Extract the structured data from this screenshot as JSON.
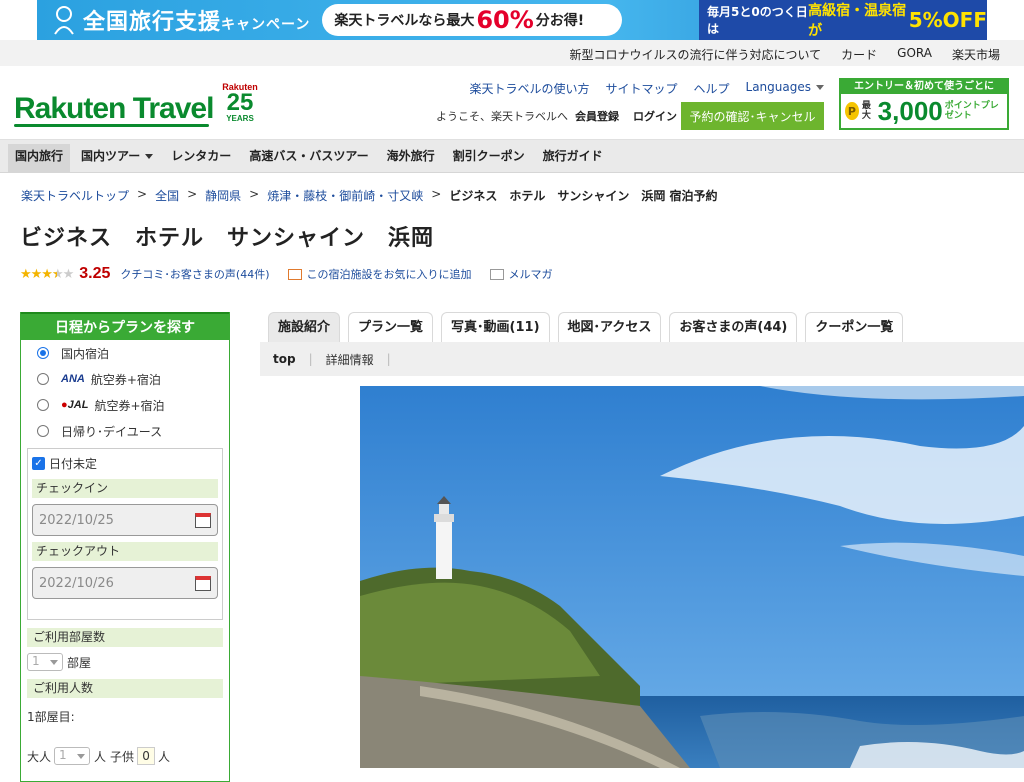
{
  "banner": {
    "title": "全国旅行支援",
    "title_suffix": "キャンペーン",
    "pill_prefix": "楽天トラベルなら最大",
    "pill_value": "60%",
    "pill_suffix": "分お得!",
    "right_prefix": "毎月5と0のつく日は",
    "right_middle": "高級宿・温泉宿が",
    "right_value": "5%OFF"
  },
  "utility": [
    "新型コロナウイルスの流行に伴う対応について",
    "カード",
    "GORA",
    "楽天市場"
  ],
  "header": {
    "logo": "Rakuten Travel",
    "years_brand": "Rakuten",
    "years_number": "25",
    "years_label": "YEARS",
    "links": [
      "楽天トラベルの使い方",
      "サイトマップ",
      "ヘルプ"
    ],
    "languages": "Languages",
    "welcome": "ようこそ、楽天トラベルへ",
    "member": "会員登録",
    "login": "ログイン",
    "confirm": "予約の確認･キャンセル",
    "promo_top": "エントリー＆初めて使うごとに",
    "promo_coin": "P",
    "promo_pre": "最大",
    "promo_amount": "3,000",
    "promo_suffix": "ポイントプレゼント"
  },
  "nav": [
    "国内旅行",
    "国内ツアー",
    "レンタカー",
    "高速バス・バスツアー",
    "海外旅行",
    "割引クーポン",
    "旅行ガイド"
  ],
  "breadcrumb": [
    "楽天トラベルトップ",
    "全国",
    "静岡県",
    "焼津・藤枝・御前崎・寸又峡"
  ],
  "breadcrumb_current": "ビジネス　ホテル　サンシャイン　浜岡 宿泊予約",
  "breadcrumb_sep": ">",
  "hotel": {
    "title": "ビジネス　ホテル　サンシャイン　浜岡",
    "rating": 3.25,
    "score": "3.25",
    "reviews": "クチコミ･お客さまの声(44件)",
    "favorite": "この宿泊施設をお気に入りに追加",
    "mailmag": "メルマガ"
  },
  "search": {
    "title": "日程からプランを探す",
    "options": [
      "国内宿泊",
      "航空券+宿泊",
      "航空券+宿泊",
      "日帰り･デイユース"
    ],
    "ana": "ANA",
    "jal": "JAL",
    "date_undecided": "日付未定",
    "checkin_label": "チェックイン",
    "checkin": "2022/10/25",
    "checkout_label": "チェックアウト",
    "checkout": "2022/10/26",
    "rooms_label": "ご利用部屋数",
    "rooms": "1",
    "rooms_unit": "部屋",
    "guests_label": "ご利用人数",
    "room1": "1部屋目:",
    "adult_label": "大人",
    "adult": "1",
    "person_unit": "人",
    "child_label": "子供",
    "child": "0"
  },
  "tabs": [
    "施設紹介",
    "プラン一覧",
    "写真･動画(11)",
    "地図･アクセス",
    "お客さまの声(44)",
    "クーポン一覧"
  ],
  "subtabs": [
    "top",
    "詳細情報"
  ],
  "colors": {
    "brand_green": "#3aaa35",
    "rakuten_red": "#bf0000",
    "link_blue": "#1d4c9c"
  }
}
